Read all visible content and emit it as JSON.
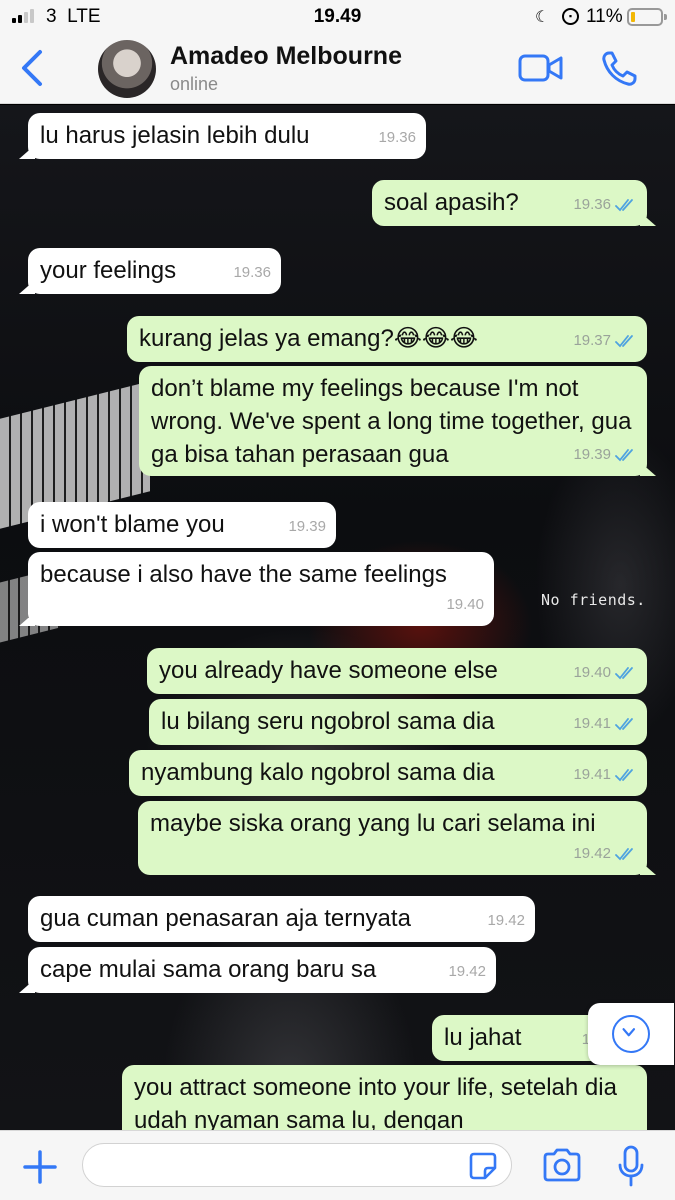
{
  "status_bar": {
    "carrier": "3",
    "network": "LTE",
    "time": "19.49",
    "battery_percent": "11%",
    "signal_bars_active": 2,
    "signal_bars_total": 4,
    "battery_level": 0.11
  },
  "header": {
    "back_icon": "chevron-left-icon",
    "contact_name": "Amadeo Melbourne",
    "contact_status": "online",
    "video_icon": "video-camera-icon",
    "call_icon": "phone-icon",
    "accent_color": "#3478f6"
  },
  "wallpaper": {
    "caption": "No friends."
  },
  "messages": [
    {
      "dir": "in",
      "text": "lu harus jelasin lebih dulu",
      "time": "19.36"
    },
    {
      "dir": "out",
      "text": "soal apasih?",
      "time": "19.36",
      "read": true
    },
    {
      "dir": "in",
      "text": "your feelings",
      "time": "19.36"
    },
    {
      "dir": "out",
      "text": "kurang jelas ya emang?😂😂😂",
      "time": "19.37",
      "read": true
    },
    {
      "dir": "out",
      "text": "don’t blame my feelings because I'm not wrong. We've spent a long time together, gua ga bisa tahan perasaan gua",
      "time": "19.39",
      "read": true
    },
    {
      "dir": "in",
      "text": "i won't blame you",
      "time": "19.39"
    },
    {
      "dir": "in",
      "text": "because i also have the same feelings",
      "time": "19.40"
    },
    {
      "dir": "out",
      "text": "you already have someone else",
      "time": "19.40",
      "read": true
    },
    {
      "dir": "out",
      "text": "lu bilang seru ngobrol sama dia",
      "time": "19.41",
      "read": true
    },
    {
      "dir": "out",
      "text": "nyambung kalo ngobrol sama dia",
      "time": "19.41",
      "read": true
    },
    {
      "dir": "out",
      "text": "maybe siska orang yang lu cari selama ini",
      "time": "19.42",
      "read": true
    },
    {
      "dir": "in",
      "text": "gua cuman penasaran aja ternyata",
      "time": "19.42"
    },
    {
      "dir": "in",
      "text": "cape mulai sama orang baru sa",
      "time": "19.42"
    },
    {
      "dir": "out",
      "text": "lu jahat",
      "time": "19.4",
      "read": true
    },
    {
      "dir": "out",
      "text": "you attract someone into your life, setelah dia udah nyaman sama lu, dengan",
      "time": "",
      "read": false
    }
  ],
  "colors": {
    "incoming_bubble": "#ffffff",
    "outgoing_bubble": "#dcf8c6",
    "read_ticks": "#4fa3e0"
  },
  "input_bar": {
    "placeholder": "",
    "plus_icon": "plus-icon",
    "sticker_icon": "sticker-icon",
    "camera_icon": "camera-icon",
    "mic_icon": "microphone-icon"
  },
  "scroll_button_icon": "chevron-down-circle-icon"
}
